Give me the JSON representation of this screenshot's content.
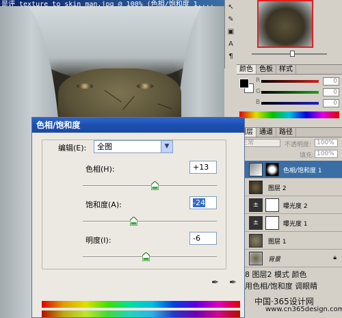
{
  "document": {
    "title": "是评 texture_to_skin_man.jpg @ 100% (色相/饱和度 1,..."
  },
  "tool_strip": {
    "icons": [
      "cursor-icon",
      "brush-icon",
      "layer-icon",
      "text-icon",
      "paragraph-icon"
    ]
  },
  "color_panel": {
    "tabs": [
      "颜色",
      "色板",
      "样式"
    ],
    "r_label": "R",
    "g_label": "G",
    "b_label": "B",
    "r_value": "0",
    "g_value": "0",
    "b_value": "0",
    "colors": {
      "r": "#d02020",
      "g": "#20a020",
      "b": "#2020c0"
    }
  },
  "layers_panel": {
    "tabs": [
      "图层",
      "通道",
      "路径"
    ],
    "blend_mode": "正常",
    "opacity_label": "不透明度:",
    "opacity_value": "100%",
    "fill_label": "填充:",
    "fill_value": "100%",
    "layers": [
      {
        "name": "色相/饱和度 1",
        "selected": true
      },
      {
        "name": "图层 2",
        "selected": false
      },
      {
        "name": "曝光度 2",
        "selected": false
      },
      {
        "name": "曝光度 1",
        "selected": false
      },
      {
        "name": "图层 1",
        "selected": false
      },
      {
        "name": "背景",
        "selected": false
      }
    ]
  },
  "dialog": {
    "title": "色相/饱和度",
    "edit_label": "编辑(E):",
    "edit_value": "全图",
    "hue_label": "色相(H):",
    "hue_value": "+13",
    "hue_level": 13,
    "saturation_label": "饱和度(A):",
    "saturation_value": "-24",
    "saturation_level": -24,
    "lightness_label": "明度(I):",
    "lightness_value": "-6",
    "lightness_level": -6
  },
  "caption": {
    "line1": "8 图层2 模式 颜色",
    "line2": "用色相/饱和度 调眼睛",
    "watermark": "中国·365设计网",
    "url": "www.cn365design.com"
  }
}
